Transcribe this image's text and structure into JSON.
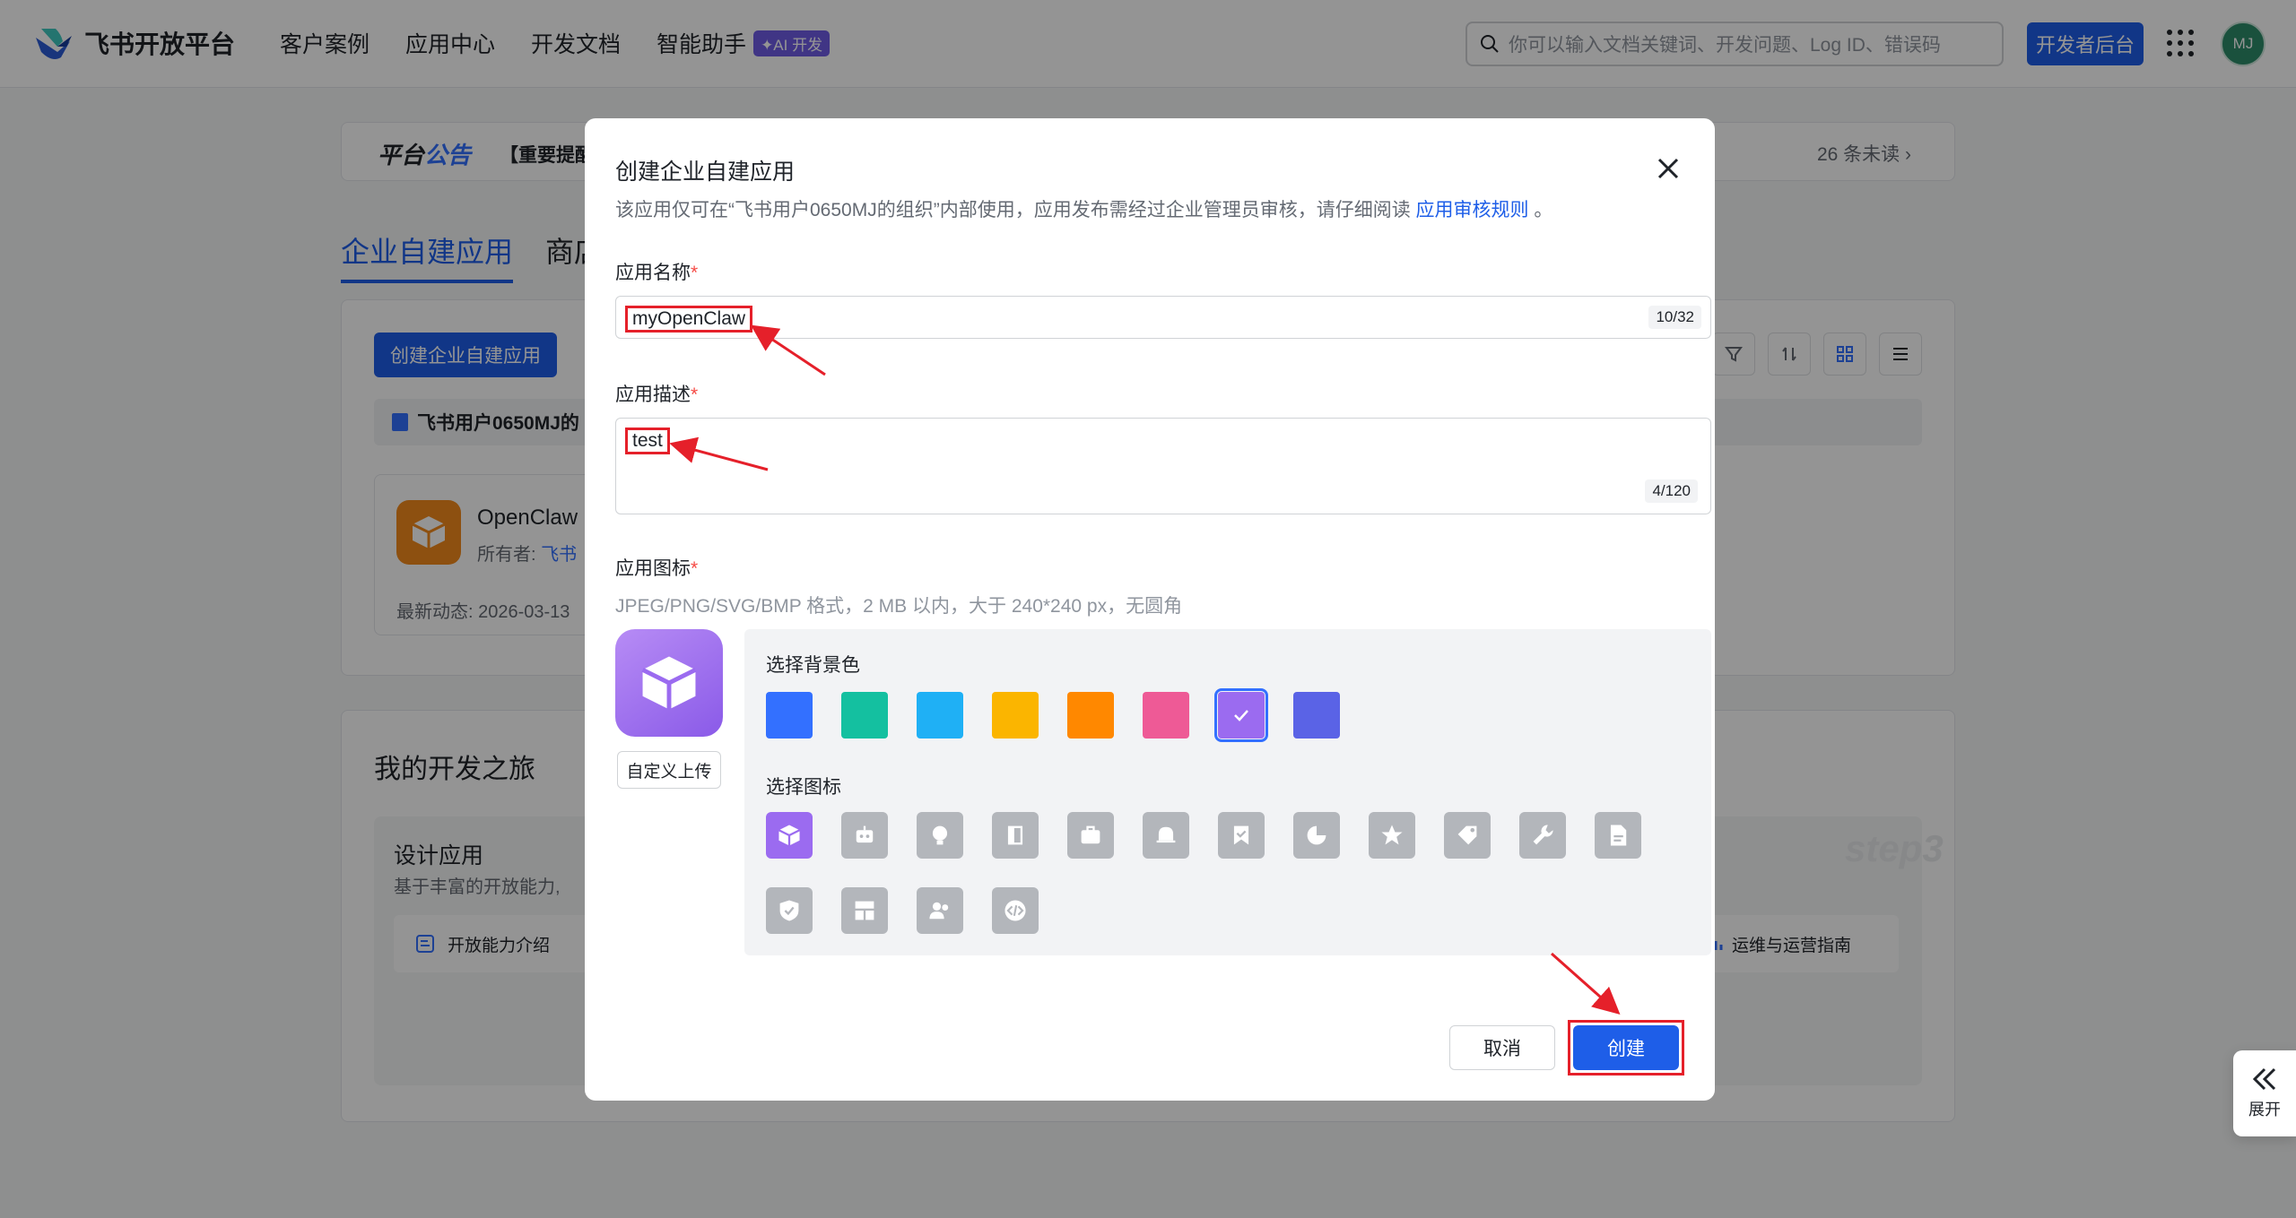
{
  "header": {
    "logo_text": "飞书开放平台",
    "nav": [
      "客户案例",
      "应用中心",
      "开发文档",
      "智能助手"
    ],
    "ai_badge": "✦AI 开发",
    "search_placeholder": "你可以输入文档关键词、开发问题、Log ID、错误码",
    "dev_console": "开发者后台",
    "avatar": "MJ"
  },
  "background": {
    "notice_title_a": "平台",
    "notice_title_b": "公告",
    "notice_text": "【重要提醒",
    "notice_unread": "26 条未读 ›",
    "tabs": [
      "企业自建应用",
      "商店"
    ],
    "create_button": "创建企业自建应用",
    "org_name": "飞书用户0650MJ的",
    "app_name": "OpenClaw",
    "app_owner_label": "所有者:",
    "app_owner_value": "飞书",
    "app_recent": "最新动态: 2026-03-13",
    "journey_title": "我的开发之旅",
    "design_title": "设计应用",
    "design_sub": "基于丰富的开放能力,",
    "design_link": "开放能力介绍",
    "ops_link": "运维与运营指南",
    "step_label": "step3",
    "expand": "展开"
  },
  "modal": {
    "title": "创建企业自建应用",
    "desc_prefix": "该应用仅可在“飞书用户0650MJ的组织”内部使用，应用发布需经过企业管理员审核，请仔细阅读 ",
    "desc_link": "应用审核规则",
    "desc_suffix": " 。",
    "name_label": "应用名称",
    "name_value": "myOpenClaw",
    "name_counter": "10/32",
    "desc_label": "应用描述",
    "desc_value": "test",
    "desc_counter": "4/120",
    "icon_label": "应用图标",
    "icon_hint": "JPEG/PNG/SVG/BMP 格式，2 MB 以内，大于 240*240 px，无圆角",
    "upload_button": "自定义上传",
    "bg_color_label": "选择背景色",
    "bg_colors": [
      "#3370ff",
      "#14c0a0",
      "#1fb0f5",
      "#fbb500",
      "#ff8800",
      "#ee5a96",
      "#9b6bf0",
      "#5a63e6"
    ],
    "selected_color_index": 6,
    "glyph_label": "选择图标",
    "glyphs": [
      "cube-icon",
      "robot-icon",
      "bulb-icon",
      "door-icon",
      "briefcase-icon",
      "bell-icon",
      "bookmark-check-icon",
      "pie-icon",
      "star-icon",
      "tag-icon",
      "wrench-icon",
      "document-icon",
      "shield-check-icon",
      "layout-icon",
      "users-icon",
      "code-icon"
    ],
    "selected_glyph_index": 0,
    "cancel_button": "取消",
    "create_button": "创建"
  }
}
